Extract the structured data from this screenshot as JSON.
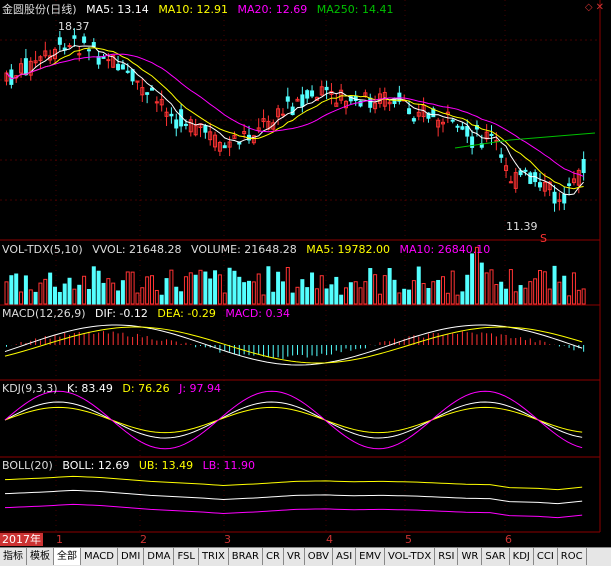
{
  "price_header": {
    "name": "金圆股份(日线)",
    "ma5": "MA5: 13.14",
    "ma10": "MA10: 12.91",
    "ma20": "MA20: 12.69",
    "ma250": "MA250: 14.41"
  },
  "vol_header": {
    "name": "VOL-TDX(5,10)",
    "vvol": "VVOL: 21648.28",
    "volume": "VOLUME: 21648.28",
    "ma5": "MA5: 19782.00",
    "ma10": "MA10: 26840.10"
  },
  "macd_header": {
    "name": "MACD(12,26,9)",
    "dif": "DIF: -0.12",
    "dea": "DEA: -0.29",
    "macd": "MACD: 0.34"
  },
  "kdj_header": {
    "name": "KDJ(9,3,3)",
    "k": "K: 83.49",
    "d": "D: 76.26",
    "j": "J: 97.94"
  },
  "boll_header": {
    "name": "BOLL(20)",
    "boll": "BOLL: 12.69",
    "ub": "UB: 13.49",
    "lb": "LB: 11.90"
  },
  "annotations": {
    "high": "18.37",
    "low": "11.39",
    "marker": "S"
  },
  "timeline": {
    "year": "2017年",
    "months": [
      "1",
      "2",
      "3",
      "4",
      "5",
      "6"
    ]
  },
  "tabs": [
    "指标",
    "模板",
    "全部",
    "MACD",
    "DMI",
    "DMA",
    "FSL",
    "TRIX",
    "BRAR",
    "CR",
    "VR",
    "OBV",
    "ASI",
    "EMV",
    "VOL-TDX",
    "RSI",
    "WR",
    "SAR",
    "KDJ",
    "CCI",
    "ROC"
  ],
  "active_tab": "全部",
  "colors": {
    "up": "#ff3333",
    "down": "#54ffff",
    "ma5": "#ffffff",
    "ma10": "#ffff00",
    "ma20": "#ff00ff",
    "ma250": "#00c000",
    "grid": "#8b0000",
    "macd_header": "#ffffff"
  }
}
